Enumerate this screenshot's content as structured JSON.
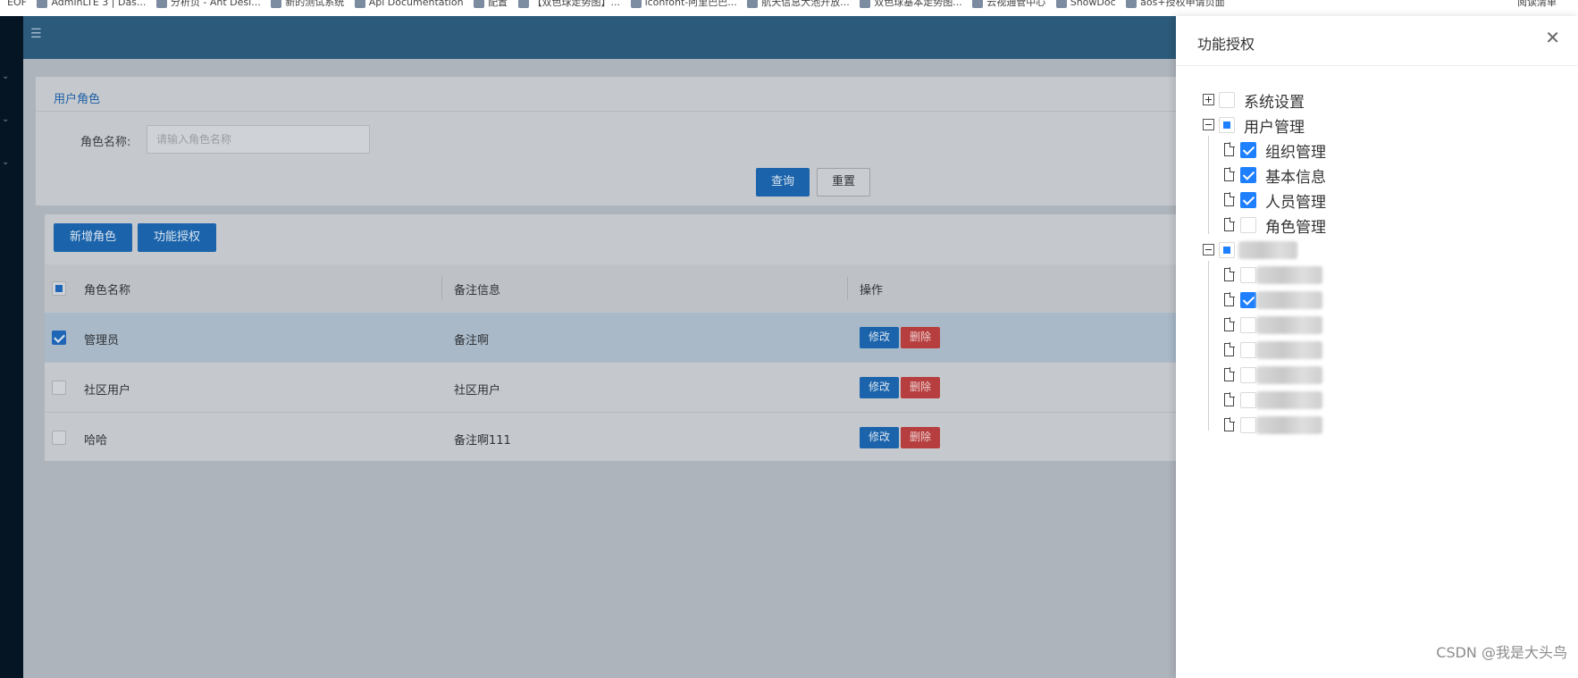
{
  "bookmarks": {
    "items": [
      "EOF",
      "AdminLTE 3 | Das...",
      "分析页 - Ant Desi...",
      "新的测试系统",
      "Api Documentation",
      "配置",
      "【双色球走势图】...",
      "iconfont-阿里巴巴...",
      "航天信息大池开放...",
      "双色球基本走势图...",
      "云视通管中心",
      "ShowDoc",
      "aos+授权申请页面"
    ],
    "right_item": "阅读清单"
  },
  "header": {
    "menu_toggle_icon": "menu-fold-icon"
  },
  "search": {
    "title": "用户角色",
    "name_label": "角色名称:",
    "name_placeholder": "请输入角色名称",
    "query_button": "查询",
    "reset_button": "重置"
  },
  "toolbar": {
    "add_button": "新增角色",
    "auth_button": "功能授权"
  },
  "table": {
    "columns": [
      "角色名称",
      "备注信息",
      "操作"
    ],
    "header_checkbox": "partial",
    "rows": [
      {
        "name": "管理员",
        "remark": "备注啊",
        "selected": true
      },
      {
        "name": "社区用户",
        "remark": "社区用户",
        "selected": false
      },
      {
        "name": "哈哈",
        "remark": "备注啊111",
        "selected": false
      }
    ],
    "edit_label": "修改",
    "delete_label": "删除"
  },
  "drawer": {
    "title": "功能授权",
    "close_icon": "close-icon",
    "tree": [
      {
        "label": "系统设置",
        "expanded": false,
        "state": "unchecked"
      },
      {
        "label": "用户管理",
        "expanded": true,
        "state": "partial",
        "children": [
          {
            "label": "组织管理",
            "state": "checked"
          },
          {
            "label": "基本信息",
            "state": "checked"
          },
          {
            "label": "人员管理",
            "state": "checked"
          },
          {
            "label": "角色管理",
            "state": "unchecked"
          }
        ]
      }
    ]
  },
  "watermark": "CSDN @我是大头鸟",
  "colors": {
    "primary": "#1e80ff",
    "danger": "#b73e3e",
    "header": "#2c5a7a",
    "sidebar": "#051524"
  }
}
